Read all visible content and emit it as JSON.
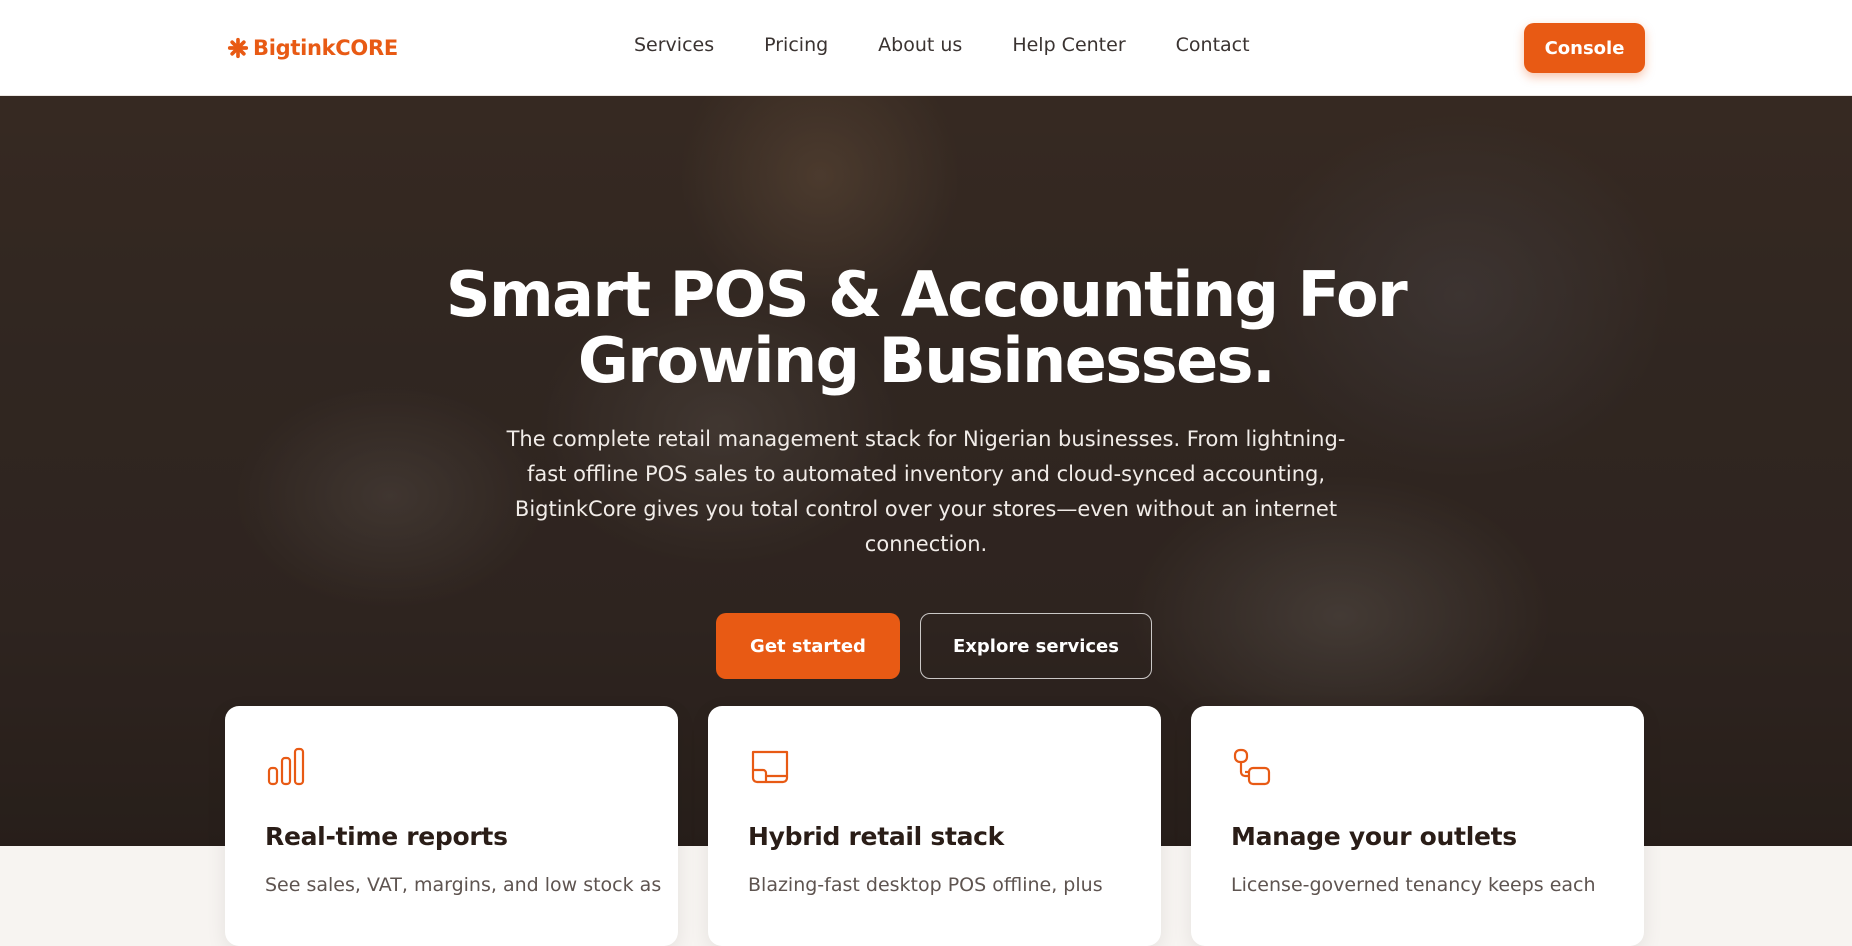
{
  "header": {
    "logo_text": "BigtinkCORE",
    "nav": [
      {
        "label": "Services"
      },
      {
        "label": "Pricing"
      },
      {
        "label": "About us"
      },
      {
        "label": "Help Center"
      },
      {
        "label": "Contact"
      }
    ],
    "console_label": "Console"
  },
  "hero": {
    "title_line1": "Smart POS & Accounting For",
    "title_line2": "Growing Businesses.",
    "description": "The complete retail management stack for Nigerian businesses. From lightning-fast offline POS sales to automated inventory and cloud-synced accounting, BigtinkCore gives you total control over your stores—even without an internet connection.",
    "primary_cta": "Get started",
    "secondary_cta": "Explore services"
  },
  "features": [
    {
      "icon": "bar-chart-icon",
      "title": "Real-time reports",
      "text": "See sales, VAT, margins, and low stock as"
    },
    {
      "icon": "monitor-stack-icon",
      "title": "Hybrid retail stack",
      "text": "Blazing-fast desktop POS offline, plus"
    },
    {
      "icon": "outlet-connection-icon",
      "title": "Manage your outlets",
      "text": "License-governed tenancy keeps each"
    }
  ],
  "colors": {
    "accent": "#e85a14",
    "header_bg": "#ffffff",
    "page_bg": "#f7f4f1"
  }
}
